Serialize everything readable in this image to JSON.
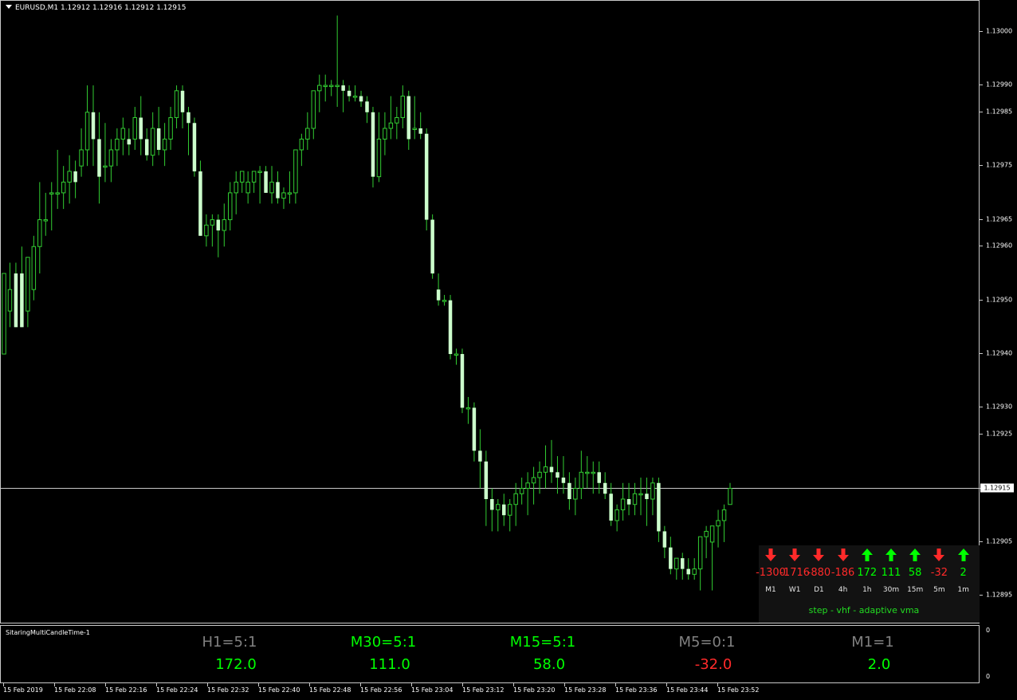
{
  "header": {
    "symbol_info": "EURUSD,M1  1.12912 1.12916 1.12912 1.12915"
  },
  "colors": {
    "candle": "#ccffcc",
    "wick": "#32cd32",
    "up": "#00ff00",
    "down": "#ff2a2a",
    "neutral": "#808080",
    "grid_line": "#c8c8c8"
  },
  "price_axis": {
    "labels": [
      "1.13000",
      "1.12990",
      "1.12985",
      "1.12975",
      "1.12965",
      "1.12960",
      "1.12950",
      "1.12940",
      "1.12930",
      "1.12925",
      "1.12905",
      "1.12895"
    ],
    "current_price": "1.12915"
  },
  "chart_data": {
    "type": "candlestick",
    "price_range": [
      1.1289,
      1.13005
    ],
    "current_price": 1.12915,
    "candles": [
      [
        1.1294,
        1.12955,
        1.1294,
        1.12955
      ],
      [
        1.12948,
        1.12957,
        1.12945,
        1.12952
      ],
      [
        1.12955,
        1.12957,
        1.12945,
        1.12945
      ],
      [
        1.12955,
        1.1296,
        1.12945,
        1.12945
      ],
      [
        1.12948,
        1.12958,
        1.12945,
        1.12958
      ],
      [
        1.12952,
        1.12962,
        1.1295,
        1.1296
      ],
      [
        1.1296,
        1.12972,
        1.12955,
        1.12965
      ],
      [
        1.12965,
        1.1297,
        1.12962,
        1.12965
      ],
      [
        1.1297,
        1.12972,
        1.12963,
        1.1297
      ],
      [
        1.1297,
        1.12978,
        1.12967,
        1.1297
      ],
      [
        1.1297,
        1.12975,
        1.12967,
        1.12972
      ],
      [
        1.12972,
        1.12977,
        1.12968,
        1.12974
      ],
      [
        1.12974,
        1.12976,
        1.12969,
        1.12972
      ],
      [
        1.12975,
        1.12982,
        1.12973,
        1.12978
      ],
      [
        1.12978,
        1.1299,
        1.12975,
        1.12985
      ],
      [
        1.12985,
        1.1299,
        1.12975,
        1.1298
      ],
      [
        1.1298,
        1.12985,
        1.12968,
        1.12973
      ],
      [
        1.12975,
        1.12983,
        1.12972,
        1.12975
      ],
      [
        1.12975,
        1.1298,
        1.12972,
        1.12978
      ],
      [
        1.12978,
        1.12982,
        1.12975,
        1.1298
      ],
      [
        1.1298,
        1.12984,
        1.12977,
        1.12982
      ],
      [
        1.1298,
        1.12982,
        1.12977,
        1.12979
      ],
      [
        1.1298,
        1.12986,
        1.12978,
        1.12984
      ],
      [
        1.12984,
        1.12988,
        1.12977,
        1.1298
      ],
      [
        1.1298,
        1.12982,
        1.12976,
        1.12977
      ],
      [
        1.12977,
        1.12985,
        1.12975,
        1.12982
      ],
      [
        1.12982,
        1.12986,
        1.12977,
        1.12978
      ],
      [
        1.12978,
        1.12983,
        1.12975,
        1.1298
      ],
      [
        1.1298,
        1.12986,
        1.12978,
        1.12984
      ],
      [
        1.12984,
        1.1299,
        1.12982,
        1.12989
      ],
      [
        1.12989,
        1.1299,
        1.12982,
        1.12985
      ],
      [
        1.12985,
        1.12986,
        1.12977,
        1.12983
      ],
      [
        1.12983,
        1.12984,
        1.12973,
        1.12974
      ],
      [
        1.12974,
        1.12976,
        1.12962,
        1.12962
      ],
      [
        1.12962,
        1.12966,
        1.1296,
        1.12964
      ],
      [
        1.12964,
        1.12966,
        1.1296,
        1.12965
      ],
      [
        1.12965,
        1.12966,
        1.12958,
        1.12963
      ],
      [
        1.12963,
        1.12968,
        1.1296,
        1.12965
      ],
      [
        1.12965,
        1.12972,
        1.12963,
        1.1297
      ],
      [
        1.1297,
        1.12974,
        1.12966,
        1.12972
      ],
      [
        1.12972,
        1.12974,
        1.1297,
        1.12974
      ],
      [
        1.1297,
        1.12974,
        1.12968,
        1.12972
      ],
      [
        1.12972,
        1.12974,
        1.1297,
        1.12974
      ],
      [
        1.12974,
        1.12975,
        1.12968,
        1.12974
      ],
      [
        1.12974,
        1.12975,
        1.1297,
        1.1297
      ],
      [
        1.1297,
        1.12975,
        1.12968,
        1.12972
      ],
      [
        1.12972,
        1.12974,
        1.12968,
        1.12969
      ],
      [
        1.12969,
        1.12971,
        1.12967,
        1.1297
      ],
      [
        1.1297,
        1.12974,
        1.12968,
        1.1297
      ],
      [
        1.1297,
        1.12977,
        1.12968,
        1.12978
      ],
      [
        1.12978,
        1.12981,
        1.12975,
        1.1298
      ],
      [
        1.1298,
        1.12985,
        1.12978,
        1.12982
      ],
      [
        1.12982,
        1.12988,
        1.1298,
        1.12989
      ],
      [
        1.12989,
        1.12992,
        1.12985,
        1.1299
      ],
      [
        1.1299,
        1.12992,
        1.12987,
        1.1299
      ],
      [
        1.1299,
        1.12991,
        1.12988,
        1.1299
      ],
      [
        1.1299,
        1.13003,
        1.12986,
        1.1299
      ],
      [
        1.1299,
        1.12991,
        1.12985,
        1.12989
      ],
      [
        1.12989,
        1.1299,
        1.12987,
        1.12988
      ],
      [
        1.12988,
        1.1299,
        1.12987,
        1.12988
      ],
      [
        1.12988,
        1.12989,
        1.12986,
        1.12987
      ],
      [
        1.12987,
        1.12988,
        1.12983,
        1.12985
      ],
      [
        1.12985,
        1.12986,
        1.12971,
        1.12973
      ],
      [
        1.12973,
        1.12985,
        1.12972,
        1.1298
      ],
      [
        1.1298,
        1.12985,
        1.12977,
        1.12982
      ],
      [
        1.12982,
        1.12988,
        1.1298,
        1.12983
      ],
      [
        1.12983,
        1.12986,
        1.1298,
        1.12984
      ],
      [
        1.12984,
        1.1299,
        1.12982,
        1.12988
      ],
      [
        1.12988,
        1.12989,
        1.12978,
        1.1298
      ],
      [
        1.12982,
        1.12988,
        1.1298,
        1.12982
      ],
      [
        1.12982,
        1.12985,
        1.1298,
        1.12981
      ],
      [
        1.12981,
        1.12982,
        1.12963,
        1.12965
      ],
      [
        1.12965,
        1.12966,
        1.12954,
        1.12955
      ],
      [
        1.12952,
        1.12955,
        1.12949,
        1.1295
      ],
      [
        1.1295,
        1.12951,
        1.12949,
        1.1295
      ],
      [
        1.1295,
        1.12951,
        1.12939,
        1.1294
      ],
      [
        1.1294,
        1.12941,
        1.12938,
        1.1294
      ],
      [
        1.1294,
        1.12941,
        1.12929,
        1.1293
      ],
      [
        1.1293,
        1.12932,
        1.12927,
        1.1293
      ],
      [
        1.1293,
        1.12931,
        1.1292,
        1.12922
      ],
      [
        1.12922,
        1.12926,
        1.12915,
        1.1292
      ],
      [
        1.1292,
        1.12922,
        1.12908,
        1.12913
      ],
      [
        1.12913,
        1.12915,
        1.12907,
        1.12911
      ],
      [
        1.12911,
        1.12913,
        1.12907,
        1.12912
      ],
      [
        1.12912,
        1.12914,
        1.12908,
        1.1291
      ],
      [
        1.1291,
        1.12913,
        1.12907,
        1.12912
      ],
      [
        1.12912,
        1.12916,
        1.12908,
        1.12914
      ],
      [
        1.12914,
        1.12917,
        1.12912,
        1.12915
      ],
      [
        1.12915,
        1.12918,
        1.1291,
        1.12916
      ],
      [
        1.12916,
        1.12919,
        1.12912,
        1.12917
      ],
      [
        1.12917,
        1.1292,
        1.12914,
        1.12918
      ],
      [
        1.12918,
        1.12923,
        1.12915,
        1.12919
      ],
      [
        1.12919,
        1.12924,
        1.12916,
        1.12918
      ],
      [
        1.12918,
        1.12921,
        1.12914,
        1.12917
      ],
      [
        1.12917,
        1.12921,
        1.12914,
        1.12916
      ],
      [
        1.12916,
        1.12918,
        1.12911,
        1.12913
      ],
      [
        1.12913,
        1.12917,
        1.1291,
        1.12915
      ],
      [
        1.12915,
        1.12922,
        1.12913,
        1.12918
      ],
      [
        1.12918,
        1.12921,
        1.12915,
        1.12918
      ],
      [
        1.12918,
        1.1292,
        1.12914,
        1.12918
      ],
      [
        1.12918,
        1.1292,
        1.12914,
        1.12916
      ],
      [
        1.12916,
        1.12918,
        1.12913,
        1.12914
      ],
      [
        1.12914,
        1.12916,
        1.12908,
        1.12909
      ],
      [
        1.12909,
        1.12912,
        1.12907,
        1.12911
      ],
      [
        1.12911,
        1.12916,
        1.12909,
        1.12913
      ],
      [
        1.12913,
        1.12916,
        1.1291,
        1.12912
      ],
      [
        1.12912,
        1.12916,
        1.1291,
        1.12914
      ],
      [
        1.12914,
        1.12917,
        1.1291,
        1.12914
      ],
      [
        1.12914,
        1.12917,
        1.12908,
        1.12913
      ],
      [
        1.12913,
        1.12917,
        1.1291,
        1.12916
      ],
      [
        1.12916,
        1.12917,
        1.12905,
        1.12907
      ],
      [
        1.12907,
        1.12908,
        1.12902,
        1.12904
      ],
      [
        1.12904,
        1.12906,
        1.12899,
        1.129
      ],
      [
        1.129,
        1.12902,
        1.12898,
        1.12902
      ],
      [
        1.12902,
        1.12903,
        1.12898,
        1.129
      ],
      [
        1.129,
        1.12902,
        1.12898,
        1.12899
      ],
      [
        1.12899,
        1.12902,
        1.12898,
        1.129
      ],
      [
        1.129,
        1.12906,
        1.12896,
        1.12906
      ],
      [
        1.12906,
        1.12908,
        1.12902,
        1.12907
      ],
      [
        1.12905,
        1.12907,
        1.12896,
        1.12908
      ],
      [
        1.12908,
        1.12911,
        1.12904,
        1.12909
      ],
      [
        1.12909,
        1.12912,
        1.12905,
        1.12911
      ],
      [
        1.12912,
        1.12916,
        1.12912,
        1.12915
      ]
    ]
  },
  "mtf_panel": {
    "items": [
      {
        "dir": "down",
        "value": "-1300",
        "tf": "M1"
      },
      {
        "dir": "down",
        "value": "-1716",
        "tf": "W1"
      },
      {
        "dir": "down",
        "value": "-880",
        "tf": "D1"
      },
      {
        "dir": "down",
        "value": "-186",
        "tf": "4h"
      },
      {
        "dir": "up",
        "value": "172",
        "tf": "1h"
      },
      {
        "dir": "up",
        "value": "111",
        "tf": "30m"
      },
      {
        "dir": "up",
        "value": "58",
        "tf": "15m"
      },
      {
        "dir": "down",
        "value": "-32",
        "tf": "5m"
      },
      {
        "dir": "up",
        "value": "2",
        "tf": "1m"
      }
    ],
    "caption": "step - vhf - adaptive vma"
  },
  "sub_window": {
    "title": "SitaringMultiCandleTime-1",
    "axis_top": "0",
    "axis_bottom": "0",
    "timers": [
      {
        "label": "H1=5:1",
        "label_color": "neutral",
        "value": "172.0",
        "value_color": "up"
      },
      {
        "label": "M30=5:1",
        "label_color": "up",
        "value": "111.0",
        "value_color": "up"
      },
      {
        "label": "M15=5:1",
        "label_color": "up",
        "value": "58.0",
        "value_color": "up"
      },
      {
        "label": "M5=0:1",
        "label_color": "neutral",
        "value": "-32.0",
        "value_color": "down"
      },
      {
        "label": "M1=1",
        "label_color": "neutral",
        "value": "2.0",
        "value_color": "up"
      }
    ]
  },
  "time_axis": {
    "labels": [
      "15 Feb 2019",
      "15 Feb 22:08",
      "15 Feb 22:16",
      "15 Feb 22:24",
      "15 Feb 22:32",
      "15 Feb 22:40",
      "15 Feb 22:48",
      "15 Feb 22:56",
      "15 Feb 23:04",
      "15 Feb 23:12",
      "15 Feb 23:20",
      "15 Feb 23:28",
      "15 Feb 23:36",
      "15 Feb 23:44",
      "15 Feb 23:52"
    ]
  }
}
